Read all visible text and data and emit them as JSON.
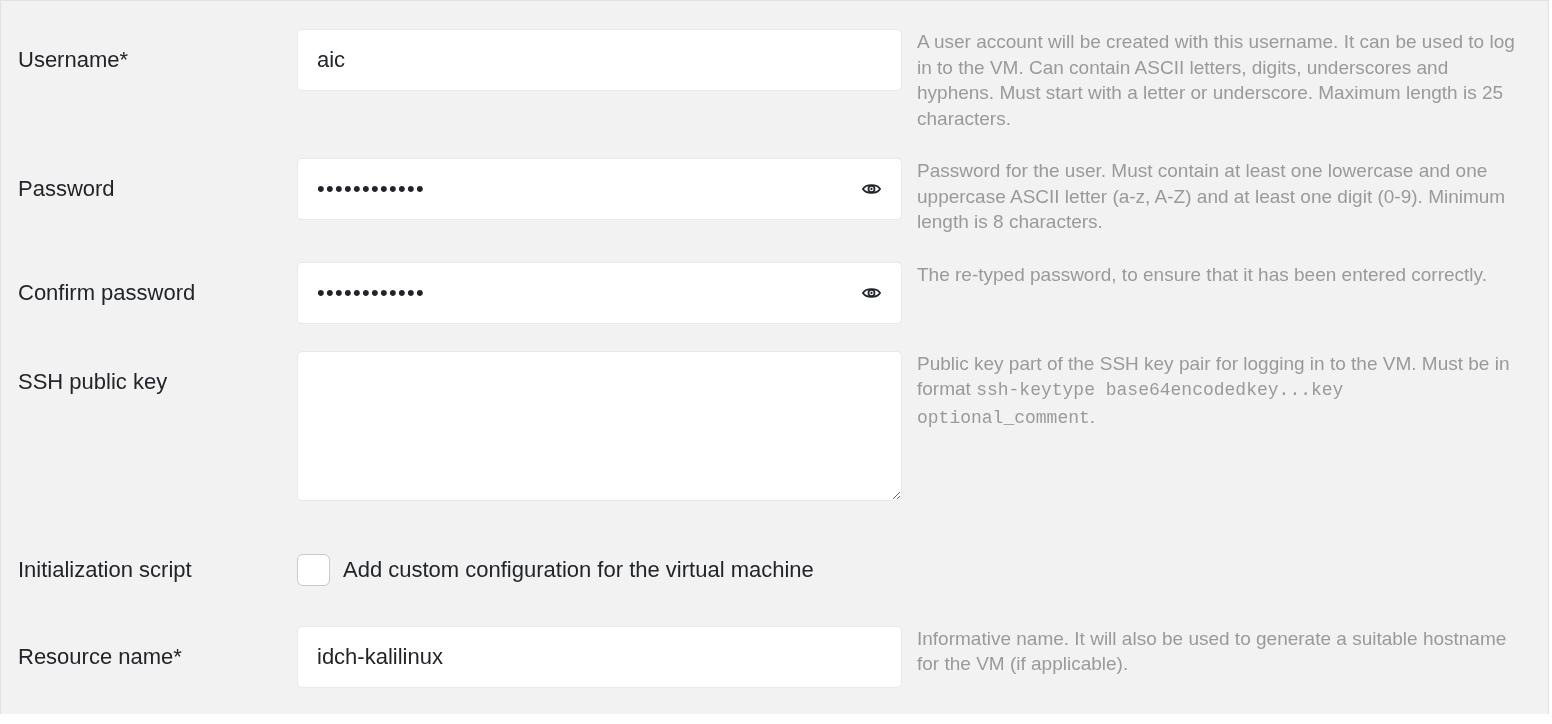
{
  "fields": [
    {
      "kind": "text",
      "label": "Username*",
      "value": "aic",
      "help": [
        {
          "kind": "prose",
          "text": "A user account will be created with this username. It can be used to log in to the VM. Can contain ASCII letters, digits, underscores and hyphens. Must start with a letter or underscore. Maximum length is 25 characters."
        }
      ]
    },
    {
      "kind": "password",
      "label": "Password",
      "value": "••••••••••••",
      "help": [
        {
          "kind": "prose",
          "text": "Password for the user. Must contain at least one lowercase and one uppercase ASCII letter (a-z, A-Z) and at least one digit (0-9). Minimum length is 8 characters."
        }
      ]
    },
    {
      "kind": "password",
      "label": "Confirm password",
      "value": "••••••••••••",
      "help": [
        {
          "kind": "prose",
          "text": "The re-typed password, to ensure that it has been entered correctly."
        }
      ]
    },
    {
      "kind": "textarea",
      "label": "SSH public key",
      "help": [
        {
          "kind": "prose",
          "text": "Public key part of the SSH key pair for logging in to the VM. Must be in format "
        },
        {
          "kind": "code",
          "text": "ssh-keytype base64encodedkey...key optional_comment"
        },
        {
          "kind": "prose",
          "text": "."
        }
      ]
    },
    {
      "kind": "checkbox",
      "label": "Initialization script",
      "option": "Add custom configuration for the virtual machine",
      "checked": false
    },
    {
      "kind": "text",
      "label": "Resource name*",
      "value": "idch-kalilinux",
      "help": [
        {
          "kind": "prose",
          "text": "Informative name. It will also be used to generate a suitable hostname for the VM (if applicable)."
        }
      ]
    }
  ]
}
